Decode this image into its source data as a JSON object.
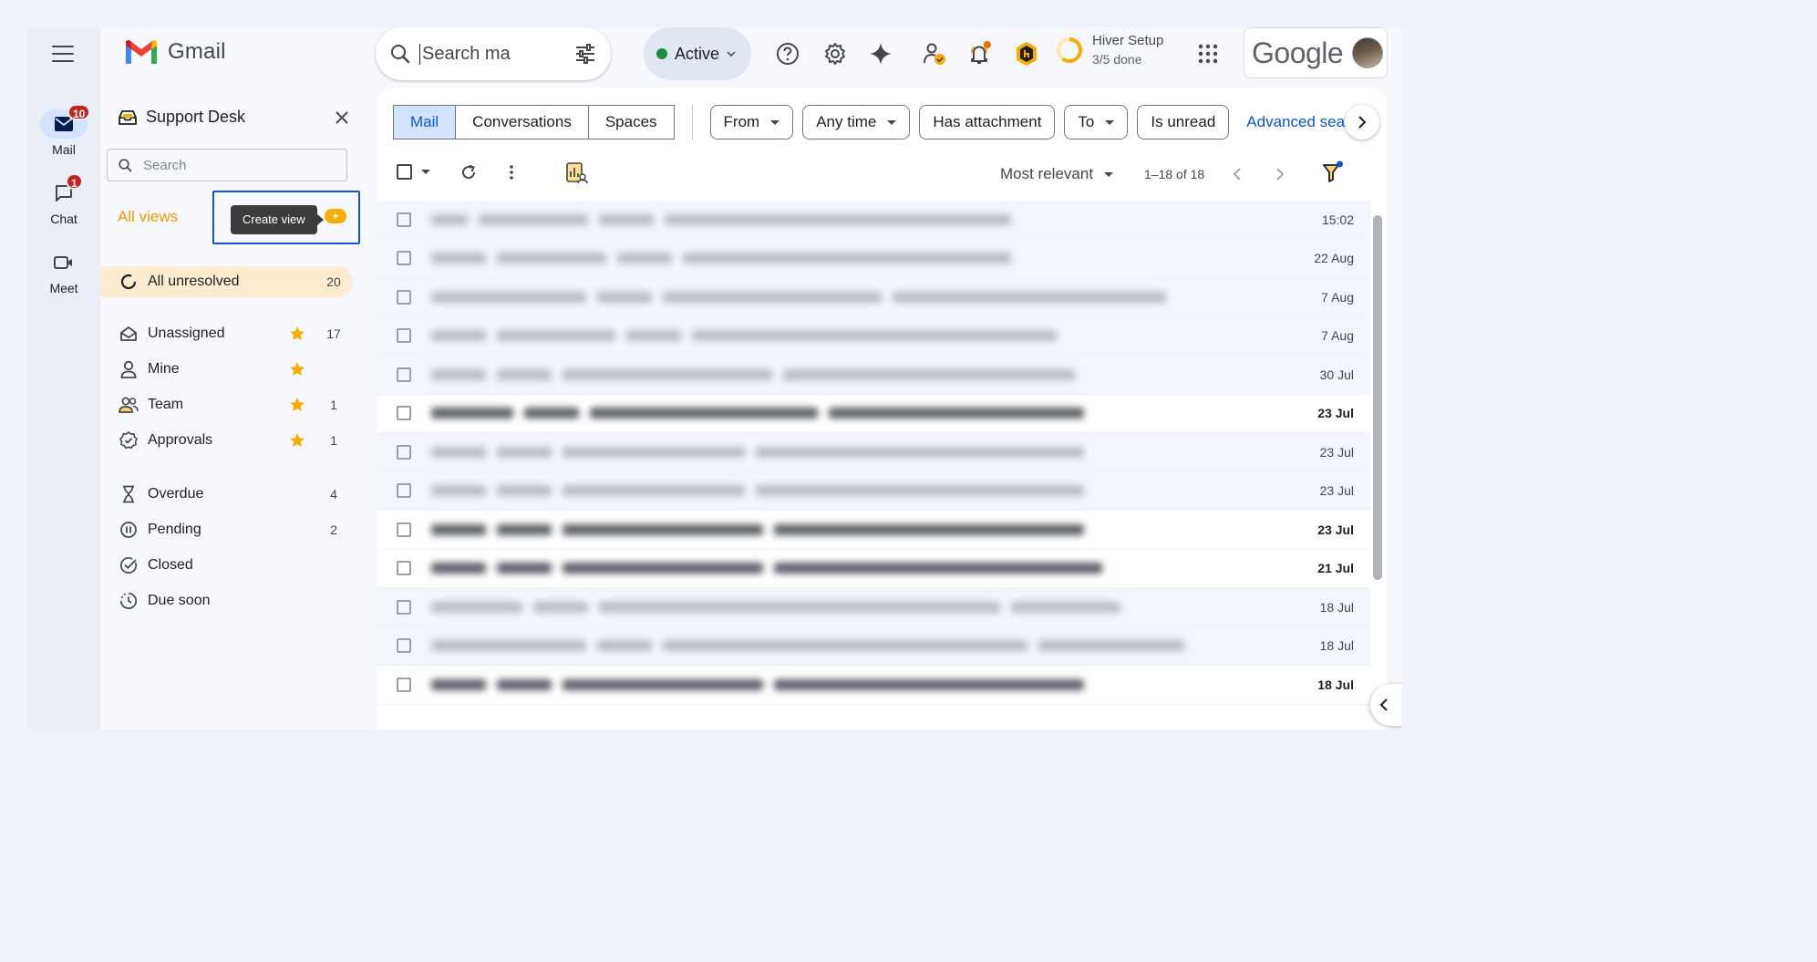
{
  "rail": {
    "items": [
      {
        "label": "Mail",
        "badge": "10"
      },
      {
        "label": "Chat",
        "badge": "1"
      },
      {
        "label": "Meet"
      }
    ]
  },
  "header": {
    "app_name": "Gmail",
    "search": {
      "value": "",
      "placeholder": "Search ma"
    },
    "status": "Active",
    "hiver_setup": {
      "title": "Hiver Setup",
      "progress_text": "3/5 done",
      "progress": 0.6
    },
    "account_brand": "Google"
  },
  "panel": {
    "title": "Support Desk",
    "search_placeholder": "Search",
    "all_views_label": "All views",
    "create_view_tooltip": "Create view",
    "create_view_symbol": "+",
    "selected_view": {
      "label": "All unresolved",
      "count": "20"
    },
    "views": [
      {
        "label": "Unassigned",
        "starred": true,
        "count": "17",
        "icon": "inbox-icon"
      },
      {
        "label": "Mine",
        "starred": true,
        "count": "",
        "icon": "person-icon"
      },
      {
        "label": "Team",
        "starred": true,
        "count": "1",
        "icon": "team-icon"
      },
      {
        "label": "Approvals",
        "starred": true,
        "count": "1",
        "icon": "approval-icon"
      }
    ],
    "status_views": [
      {
        "label": "Overdue",
        "count": "4",
        "icon": "hourglass-icon"
      },
      {
        "label": "Pending",
        "count": "2",
        "icon": "pause-icon"
      },
      {
        "label": "Closed",
        "count": "",
        "icon": "check-circle-icon"
      },
      {
        "label": "Due soon",
        "count": "",
        "icon": "clock-icon"
      }
    ]
  },
  "main": {
    "tabs": [
      {
        "label": "Mail",
        "active": true
      },
      {
        "label": "Conversations",
        "active": false
      },
      {
        "label": "Spaces",
        "active": false
      }
    ],
    "filters": [
      {
        "label": "From",
        "dropdown": true
      },
      {
        "label": "Any time",
        "dropdown": true
      },
      {
        "label": "Has attachment",
        "dropdown": false
      },
      {
        "label": "To",
        "dropdown": true
      },
      {
        "label": "Is unread",
        "dropdown": false
      }
    ],
    "advanced_search": "Advanced search",
    "sort": "Most relevant",
    "range": "1–18 of 18",
    "emails": [
      {
        "date": "15:02",
        "unread": false
      },
      {
        "date": "22 Aug",
        "unread": false
      },
      {
        "date": "7 Aug",
        "unread": false
      },
      {
        "date": "7 Aug",
        "unread": false
      },
      {
        "date": "30 Jul",
        "unread": false
      },
      {
        "date": "23 Jul",
        "unread": true
      },
      {
        "date": "23 Jul",
        "unread": false
      },
      {
        "date": "23 Jul",
        "unread": false
      },
      {
        "date": "23 Jul",
        "unread": true
      },
      {
        "date": "21 Jul",
        "unread": true
      },
      {
        "date": "18 Jul",
        "unread": false
      },
      {
        "date": "18 Jul",
        "unread": false
      },
      {
        "date": "18 Jul",
        "unread": true
      }
    ]
  },
  "colors": {
    "accent": "#0b57d0",
    "all_views": "#f29900",
    "badge": "#c5221f",
    "highlight_box": "#1a4fd6",
    "selected_view_bg": "#fdeccf"
  }
}
